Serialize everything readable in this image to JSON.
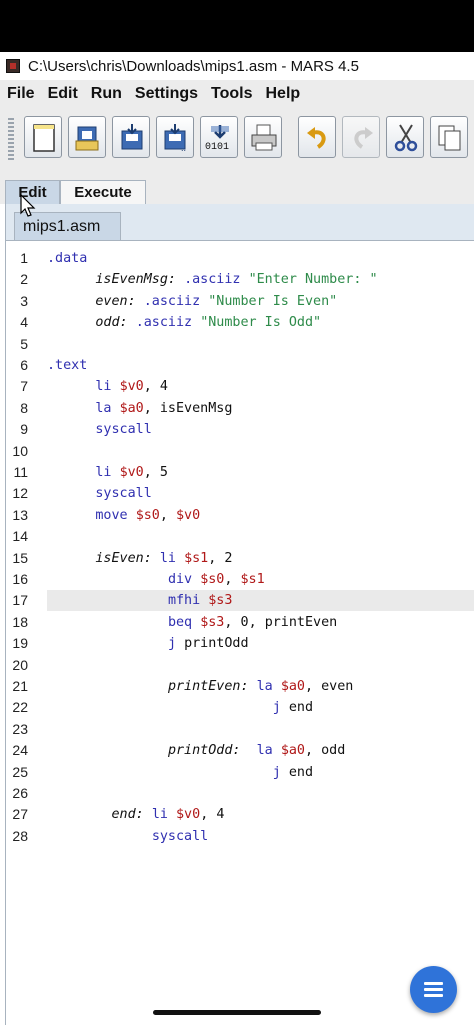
{
  "window": {
    "title": "C:\\Users\\chris\\Downloads\\mips1.asm  - MARS 4.5"
  },
  "menu": {
    "file": "File",
    "edit": "Edit",
    "run": "Run",
    "settings": "Settings",
    "tools": "Tools",
    "help": "Help"
  },
  "toolbar": {
    "buttons": [
      "new-file",
      "open",
      "save",
      "save-as",
      "dump-memory",
      "print",
      "undo",
      "redo",
      "cut",
      "copy"
    ],
    "dump_label": "0101"
  },
  "tabs": {
    "edit": "Edit",
    "execute": "Execute",
    "active": "Edit"
  },
  "file_tab": {
    "name": "mips1.asm"
  },
  "editor": {
    "highlighted_line": 17,
    "lines": [
      {
        "n": "1",
        "text": ".data"
      },
      {
        "n": "2",
        "text": "      isEvenMsg: .asciiz \"Enter Number: \""
      },
      {
        "n": "3",
        "text": "      even: .asciiz \"Number Is Even\""
      },
      {
        "n": "4",
        "text": "      odd: .asciiz \"Number Is Odd\""
      },
      {
        "n": "5",
        "text": ""
      },
      {
        "n": "6",
        "text": ".text"
      },
      {
        "n": "7",
        "text": "      li $v0, 4"
      },
      {
        "n": "8",
        "text": "      la $a0, isEvenMsg"
      },
      {
        "n": "9",
        "text": "      syscall"
      },
      {
        "n": "10",
        "text": ""
      },
      {
        "n": "11",
        "text": "      li $v0, 5"
      },
      {
        "n": "12",
        "text": "      syscall"
      },
      {
        "n": "13",
        "text": "      move $s0, $v0"
      },
      {
        "n": "14",
        "text": ""
      },
      {
        "n": "15",
        "text": "      isEven: li $s1, 2"
      },
      {
        "n": "16",
        "text": "               div $s0, $s1"
      },
      {
        "n": "17",
        "text": "               mfhi $s3"
      },
      {
        "n": "18",
        "text": "               beq $s3, 0, printEven"
      },
      {
        "n": "19",
        "text": "               j printOdd"
      },
      {
        "n": "20",
        "text": ""
      },
      {
        "n": "21",
        "text": "               printEven: la $a0, even"
      },
      {
        "n": "22",
        "text": "                            j end"
      },
      {
        "n": "23",
        "text": ""
      },
      {
        "n": "24",
        "text": "               printOdd:  la $a0, odd"
      },
      {
        "n": "25",
        "text": "                            j end"
      },
      {
        "n": "26",
        "text": ""
      },
      {
        "n": "27",
        "text": "        end: li $v0, 4"
      },
      {
        "n": "28",
        "text": "             syscall"
      }
    ]
  },
  "colors": {
    "directive": "#3030b0",
    "register": "#b01818",
    "string": "#2e8b4a",
    "active_tab": "#c9d7e6",
    "fab": "#2f73d9"
  },
  "fab": {
    "icon": "menu-icon"
  }
}
